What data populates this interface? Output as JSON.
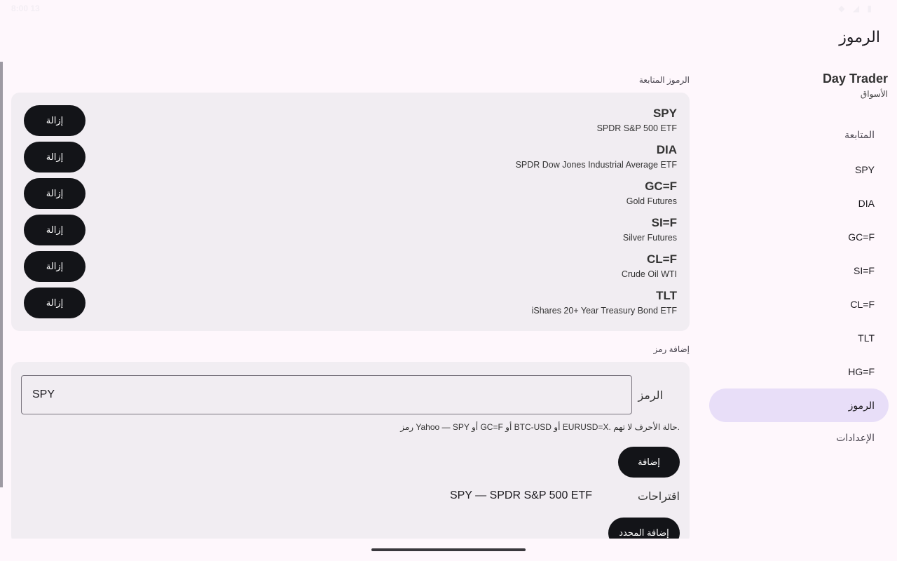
{
  "status_bar": {
    "time": "8:00 13",
    "icons": "◆ ◢ ▮"
  },
  "app_bar": {
    "title": "الرموز"
  },
  "nav": {
    "brand_title": "Day Trader",
    "brand_subtitle": "الأسواق",
    "items": [
      {
        "label": "المتابعة",
        "kind": "section"
      },
      {
        "label": "SPY",
        "kind": "symbol"
      },
      {
        "label": "DIA",
        "kind": "symbol"
      },
      {
        "label": "GC=F",
        "kind": "symbol"
      },
      {
        "label": "SI=F",
        "kind": "symbol"
      },
      {
        "label": "CL=F",
        "kind": "symbol"
      },
      {
        "label": "TLT",
        "kind": "symbol"
      },
      {
        "label": "HG=F",
        "kind": "symbol"
      },
      {
        "label": "الرموز",
        "kind": "active"
      },
      {
        "label": "الإعدادات",
        "kind": "section"
      }
    ]
  },
  "watched": {
    "heading": "الرموز المتابعة",
    "remove_label": "إزالة",
    "rows": [
      {
        "symbol": "SPY",
        "name": "SPDR S&P 500 ETF"
      },
      {
        "symbol": "DIA",
        "name": "SPDR Dow Jones Industrial Average ETF"
      },
      {
        "symbol": "GC=F",
        "name": "Gold Futures"
      },
      {
        "symbol": "SI=F",
        "name": "Silver Futures"
      },
      {
        "symbol": "CL=F",
        "name": "Crude Oil WTI"
      },
      {
        "symbol": "TLT",
        "name": "iShares 20+ Year Treasury Bond ETF"
      }
    ]
  },
  "add": {
    "heading": "إضافة رمز",
    "field_label": "الرمز",
    "field_value": "SPY",
    "helper": "رمز Yahoo — SPY أو GC=F أو BTC-USD أو EURUSD=X. حالة الأحرف لا تهم.",
    "add_button": "إضافة",
    "suggestions_label": "اقتراحات",
    "suggestion": "SPY — SPDR S&P 500 ETF",
    "add_selected_button": "إضافة المحدد"
  }
}
